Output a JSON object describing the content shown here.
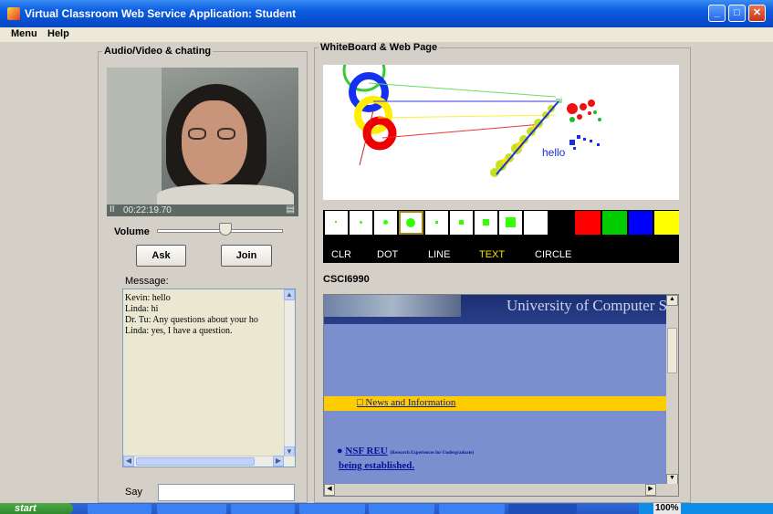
{
  "window": {
    "title": "Virtual Classroom Web Service Application: Student",
    "accent": "#0a5ce0"
  },
  "menu": {
    "items": [
      "Menu",
      "Help"
    ]
  },
  "av_panel": {
    "title": "Audio/Video & chating",
    "video_time": "00:22:19.70",
    "volume_label": "Volume",
    "volume_level": 0.55,
    "ask_label": "Ask",
    "join_label": "Join",
    "message_label": "Message:",
    "messages": [
      "Kevin: hello",
      "Linda: hi",
      "Dr. Tu: Any questions about your ho",
      "Linda: yes, I have a question."
    ],
    "say_label": "Say",
    "say_value": ""
  },
  "wb_panel": {
    "title": "WhiteBoard & Web Page",
    "whiteboard_text": "hello",
    "palette_colors": [
      "#ff0000",
      "#00cc00",
      "#0000ff",
      "#ffff00"
    ],
    "tools": [
      "CLR",
      "DOT",
      "LINE",
      "TEXT",
      "CIRCLE"
    ],
    "active_tool": "TEXT",
    "course_label": "CSCI6990",
    "web": {
      "banner_text": "University of Computer Sc",
      "news_link": "News and Information",
      "nsf_link": "NSF REU",
      "nsf_small": "(Research Experiences for Undergraduate)",
      "nsf_line2": "being established."
    }
  },
  "taskbar": {
    "start_label": "start",
    "zoom": "100%"
  }
}
